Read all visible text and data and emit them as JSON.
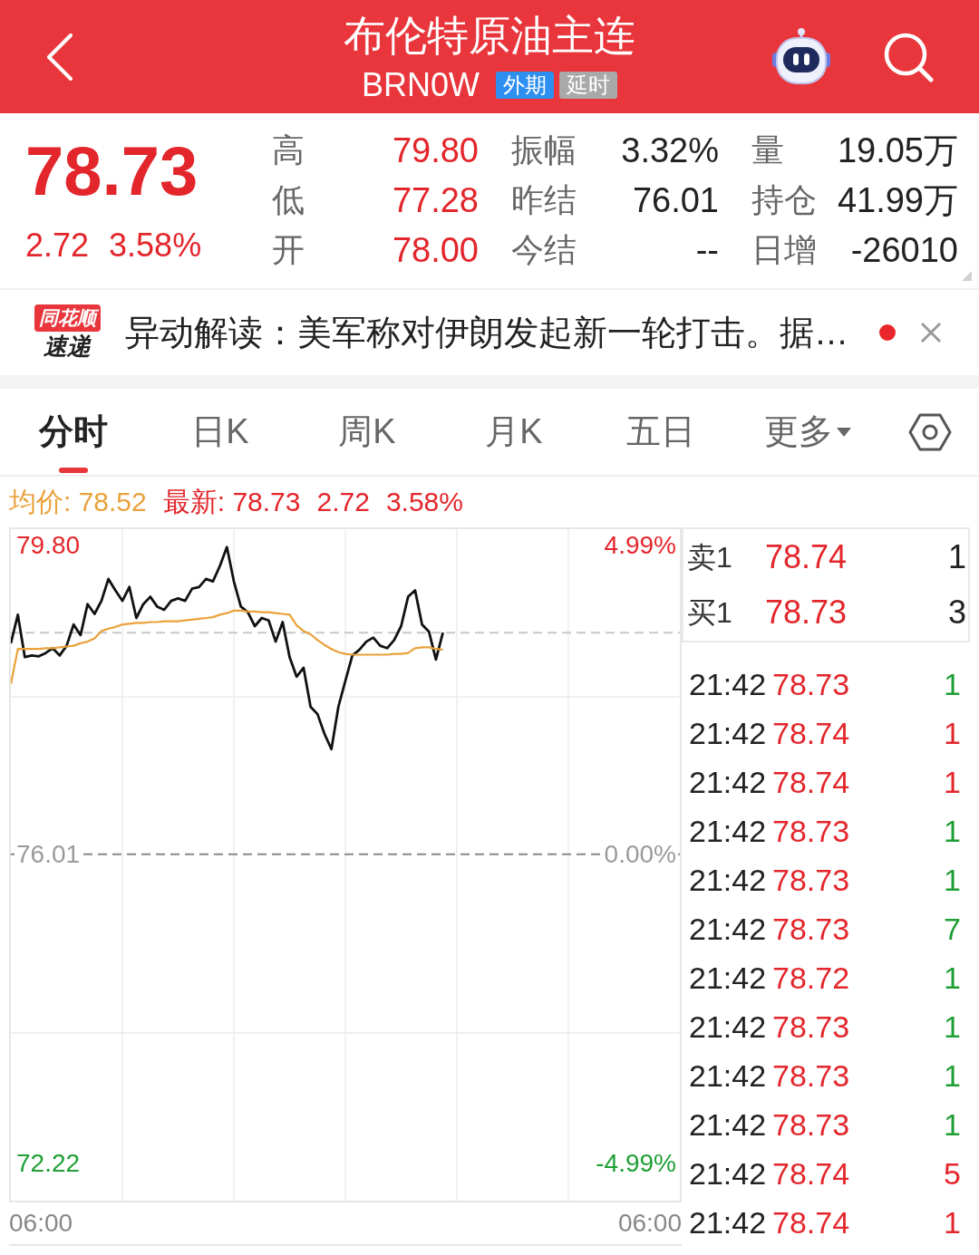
{
  "header": {
    "title": "布伦特原油主连",
    "code": "BRN0W",
    "badges": [
      {
        "text": "外期",
        "color": "#2d8ff0"
      },
      {
        "text": "延时",
        "color": "#a9a9a9"
      }
    ]
  },
  "quote": {
    "price": "78.73",
    "change": "2.72",
    "change_pct": "3.58%",
    "stats": [
      {
        "label": "高",
        "value": "79.80",
        "color": "#e3262b"
      },
      {
        "label": "振幅",
        "value": "3.32%",
        "color": "#222222"
      },
      {
        "label": "量",
        "value": "19.05万",
        "color": "#222222"
      },
      {
        "label": "低",
        "value": "77.28",
        "color": "#e3262b"
      },
      {
        "label": "昨结",
        "value": "76.01",
        "color": "#222222"
      },
      {
        "label": "持仓",
        "value": "41.99万",
        "color": "#222222"
      },
      {
        "label": "开",
        "value": "78.00",
        "color": "#e3262b"
      },
      {
        "label": "今结",
        "value": "--",
        "color": "#222222"
      },
      {
        "label": "日增",
        "value": "-26010",
        "color": "#222222"
      }
    ]
  },
  "notice": {
    "logo_top": "同花顺",
    "logo_bottom": "速递",
    "text": "异动解读：美军称对伊朗发起新一轮打击。据…"
  },
  "tabs": [
    {
      "label": "分时",
      "selected": true,
      "kind": "view"
    },
    {
      "label": "日K",
      "selected": false,
      "kind": "view"
    },
    {
      "label": "周K",
      "selected": false,
      "kind": "view"
    },
    {
      "label": "月K",
      "selected": false,
      "kind": "view"
    },
    {
      "label": "五日",
      "selected": false,
      "kind": "view"
    },
    {
      "label": "更多",
      "selected": false,
      "kind": "menu"
    }
  ],
  "chart": {
    "info": [
      {
        "text": "均价: 78.52",
        "color": "#e9a23b"
      },
      {
        "text": "最新: 78.73",
        "color": "#e3262b"
      },
      {
        "text": "2.72",
        "color": "#e3262b"
      },
      {
        "text": "3.58%",
        "color": "#e3262b"
      }
    ],
    "chart_data": {
      "type": "line",
      "grid": true,
      "ylim": [
        71.76,
        80.0
      ],
      "yticks": [
        {
          "value": 72.22,
          "label": "72.22"
        },
        {
          "value": 76.01,
          "label": "76.01"
        },
        {
          "value": 79.8,
          "label": "79.80"
        }
      ],
      "series": [
        {
          "color": "#111111",
          "values": [
            78.6,
            78.95,
            78.43,
            78.45,
            78.44,
            78.48,
            78.54,
            78.45,
            78.57,
            78.83,
            78.7,
            79.08,
            78.96,
            79.12,
            79.39,
            79.25,
            79.12,
            79.29,
            78.91,
            79.08,
            79.17,
            79.05,
            79.01,
            79.12,
            79.15,
            79.12,
            79.27,
            79.29,
            79.39,
            79.36,
            79.55,
            79.78,
            79.36,
            79.05,
            78.98,
            78.81,
            78.91,
            78.88,
            78.62,
            78.86,
            78.43,
            78.19,
            78.3,
            77.82,
            77.73,
            77.49,
            77.3,
            77.82,
            78.14,
            78.45,
            78.52,
            78.62,
            78.67,
            78.57,
            78.54,
            78.64,
            78.81,
            79.17,
            79.25,
            78.83,
            78.74,
            78.4,
            78.73,
            null,
            null,
            null,
            null,
            null,
            null,
            null,
            null,
            null,
            null,
            null,
            null,
            null,
            null,
            null,
            null,
            null,
            null,
            null,
            null,
            null,
            null,
            null,
            null,
            null,
            null,
            null,
            null,
            null,
            null,
            null,
            null,
            null
          ]
        },
        {
          "color": "#e9a23b",
          "values": [
            78.1,
            78.53,
            78.53,
            78.53,
            78.53,
            78.54,
            78.54,
            78.55,
            78.56,
            78.57,
            78.6,
            78.62,
            78.66,
            78.75,
            78.78,
            78.8,
            78.83,
            78.84,
            78.85,
            78.85,
            78.86,
            78.86,
            78.87,
            78.87,
            78.87,
            78.88,
            78.89,
            78.9,
            78.91,
            78.92,
            78.95,
            78.97,
            79.0,
            79.0,
            78.99,
            78.99,
            78.98,
            78.98,
            78.97,
            78.96,
            78.95,
            78.82,
            78.75,
            78.71,
            78.64,
            78.58,
            78.53,
            78.49,
            78.47,
            78.46,
            78.46,
            78.46,
            78.46,
            78.46,
            78.46,
            78.47,
            78.47,
            78.48,
            78.54,
            78.55,
            78.55,
            78.53,
            78.52,
            null,
            null,
            null,
            null,
            null,
            null,
            null,
            null,
            null,
            null,
            null,
            null,
            null,
            null,
            null,
            null,
            null,
            null,
            null,
            null,
            null,
            null,
            null,
            null,
            null,
            null,
            null,
            null,
            null,
            null,
            null,
            null,
            null
          ]
        }
      ],
      "ref_lines": [
        {
          "axis": "y",
          "value": 76.01,
          "color": "#888888"
        },
        {
          "axis": "y",
          "value": 78.73,
          "color": "#c8c8c8"
        }
      ]
    },
    "percent_labels": [
      "4.99%",
      "0.00%",
      "-4.99%"
    ],
    "time_labels": [
      "06:00",
      "06:00"
    ]
  },
  "order_book": [
    {
      "label": "卖1",
      "price": "78.74",
      "volume": "1"
    },
    {
      "label": "买1",
      "price": "78.73",
      "volume": "3"
    }
  ],
  "trades": [
    {
      "time": "21:42",
      "price": "78.73",
      "volume": "1",
      "color": "#1f9f35"
    },
    {
      "time": "21:42",
      "price": "78.74",
      "volume": "1",
      "color": "#e3262b"
    },
    {
      "time": "21:42",
      "price": "78.74",
      "volume": "1",
      "color": "#e3262b"
    },
    {
      "time": "21:42",
      "price": "78.73",
      "volume": "1",
      "color": "#1f9f35"
    },
    {
      "time": "21:42",
      "price": "78.73",
      "volume": "1",
      "color": "#1f9f35"
    },
    {
      "time": "21:42",
      "price": "78.73",
      "volume": "7",
      "color": "#1f9f35"
    },
    {
      "time": "21:42",
      "price": "78.72",
      "volume": "1",
      "color": "#1f9f35"
    },
    {
      "time": "21:42",
      "price": "78.73",
      "volume": "1",
      "color": "#1f9f35"
    },
    {
      "time": "21:42",
      "price": "78.73",
      "volume": "1",
      "color": "#1f9f35"
    },
    {
      "time": "21:42",
      "price": "78.73",
      "volume": "1",
      "color": "#1f9f35"
    },
    {
      "time": "21:42",
      "price": "78.74",
      "volume": "5",
      "color": "#e3262b"
    },
    {
      "time": "21:42",
      "price": "78.74",
      "volume": "1",
      "color": "#e3262b"
    }
  ]
}
